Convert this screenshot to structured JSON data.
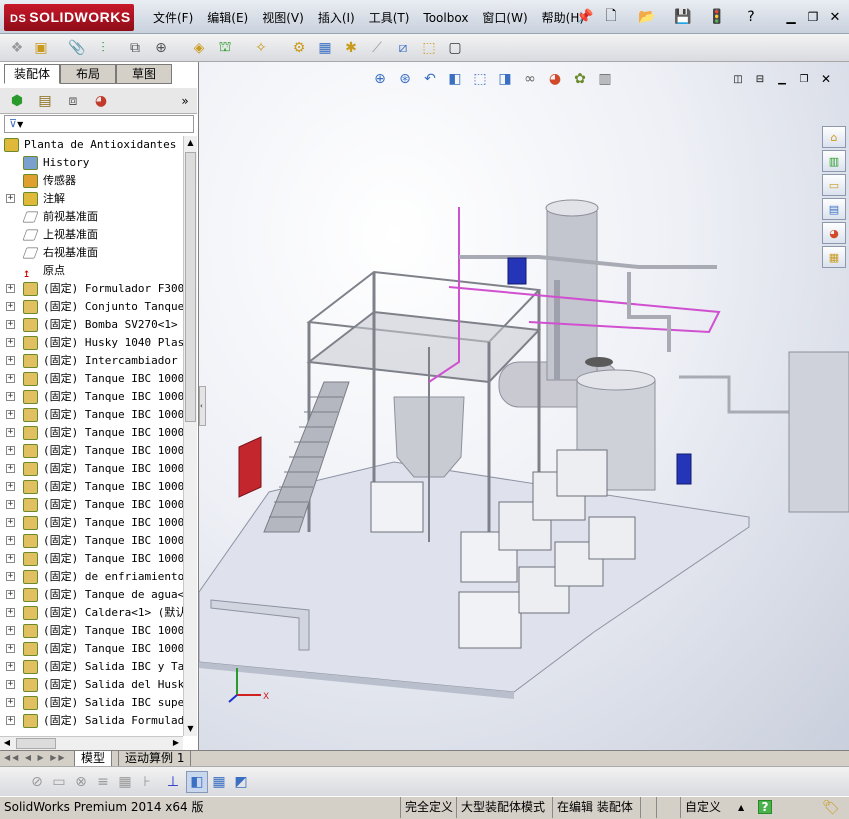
{
  "app": {
    "logo_text": "SOLIDWORKS",
    "logo_mark": "DS"
  },
  "menu": [
    "文件(F)",
    "编辑(E)",
    "视图(V)",
    "插入(I)",
    "工具(T)",
    "Toolbox",
    "窗口(W)",
    "帮助(H)"
  ],
  "fm_tabs": [
    "装配体",
    "布局",
    "草图"
  ],
  "filter": {
    "label": "▼"
  },
  "tree": [
    {
      "label": "Planta de Antioxidantes pa",
      "icon": "assembly-icon",
      "exp": false,
      "indent": 0
    },
    {
      "label": "History",
      "icon": "history-icon",
      "exp": false,
      "indent": 1
    },
    {
      "label": "传感器",
      "icon": "sensor-icon",
      "exp": false,
      "indent": 1
    },
    {
      "label": "注解",
      "icon": "annotation-icon",
      "exp": true,
      "indent": 1
    },
    {
      "label": "前视基准面",
      "icon": "plane-icon",
      "exp": false,
      "indent": 1
    },
    {
      "label": "上视基准面",
      "icon": "plane-icon",
      "exp": false,
      "indent": 1
    },
    {
      "label": "右视基准面",
      "icon": "plane-icon",
      "exp": false,
      "indent": 1
    },
    {
      "label": "原点",
      "icon": "origin-icon",
      "exp": false,
      "indent": 1
    },
    {
      "label": "(固定) Formulador F300<",
      "icon": "component-icon",
      "exp": true,
      "indent": 1
    },
    {
      "label": "(固定) Conjunto Tanque",
      "icon": "component-icon",
      "exp": true,
      "indent": 1
    },
    {
      "label": "(固定) Bomba SV270<1> (",
      "icon": "component-icon",
      "exp": true,
      "indent": 1
    },
    {
      "label": "(固定) Husky 1040 Plast",
      "icon": "component-icon",
      "exp": true,
      "indent": 1
    },
    {
      "label": "(固定) Intercambiador A",
      "icon": "component-icon",
      "exp": true,
      "indent": 1
    },
    {
      "label": "(固定) Tanque IBC 1000L",
      "icon": "component-icon",
      "exp": true,
      "indent": 1
    },
    {
      "label": "(固定) Tanque IBC 1000L",
      "icon": "component-icon",
      "exp": true,
      "indent": 1
    },
    {
      "label": "(固定) Tanque IBC 1000L",
      "icon": "component-icon",
      "exp": true,
      "indent": 1
    },
    {
      "label": "(固定) Tanque IBC 1000L",
      "icon": "component-icon",
      "exp": true,
      "indent": 1
    },
    {
      "label": "(固定) Tanque IBC 1000L",
      "icon": "component-icon",
      "exp": true,
      "indent": 1
    },
    {
      "label": "(固定) Tanque IBC 1000L",
      "icon": "component-icon",
      "exp": true,
      "indent": 1
    },
    {
      "label": "(固定) Tanque IBC 1000L",
      "icon": "component-icon",
      "exp": true,
      "indent": 1
    },
    {
      "label": "(固定) Tanque IBC 1000L",
      "icon": "component-icon",
      "exp": true,
      "indent": 1
    },
    {
      "label": "(固定) Tanque IBC 1000L",
      "icon": "component-icon",
      "exp": true,
      "indent": 1
    },
    {
      "label": "(固定) Tanque IBC 1000L",
      "icon": "component-icon",
      "exp": true,
      "indent": 1
    },
    {
      "label": "(固定) Tanque IBC 1000L",
      "icon": "component-icon",
      "exp": true,
      "indent": 1
    },
    {
      "label": "(固定) de enfriamiento",
      "icon": "component-icon",
      "exp": true,
      "indent": 1
    },
    {
      "label": "(固定) Tanque de agua<1",
      "icon": "component-icon",
      "exp": true,
      "indent": 1
    },
    {
      "label": "(固定) Caldera<1> (默认",
      "icon": "component-icon",
      "exp": true,
      "indent": 1
    },
    {
      "label": "(固定) Tanque IBC 1000L",
      "icon": "component-icon",
      "exp": true,
      "indent": 1
    },
    {
      "label": "(固定) Tanque IBC 1000L",
      "icon": "component-icon",
      "exp": true,
      "indent": 1
    },
    {
      "label": "(固定) Salida IBC y Tan",
      "icon": "component-icon",
      "exp": true,
      "indent": 1
    },
    {
      "label": "(固定) Salida del Husky",
      "icon": "component-icon",
      "exp": true,
      "indent": 1
    },
    {
      "label": "(固定) Salida IBC super",
      "icon": "component-icon",
      "exp": true,
      "indent": 1
    },
    {
      "label": "(固定) Salida Formulado",
      "icon": "component-icon",
      "exp": true,
      "indent": 1
    }
  ],
  "bottom_tabs": [
    "模型",
    "运动算例 1"
  ],
  "status": {
    "product": "SolidWorks Premium 2014 x64 版",
    "state": "完全定义",
    "mode": "大型装配体模式",
    "editing": "在编辑 装配体",
    "units": "自定义",
    "help": "?"
  },
  "colors": {
    "brand": "#c8182a",
    "pipe_pink": "#d050d0",
    "frame": "#8a8d94"
  }
}
